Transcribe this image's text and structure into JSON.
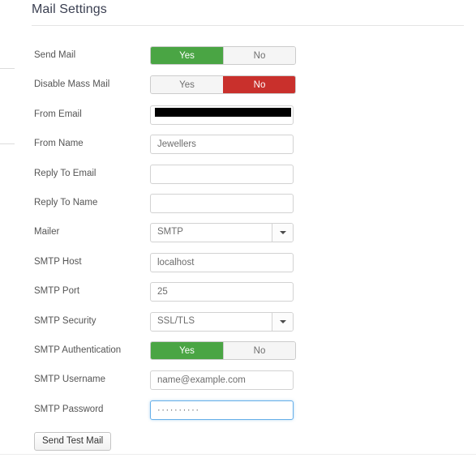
{
  "panel": {
    "title": "Mail Settings"
  },
  "form": {
    "rows": [
      {
        "label": "Send Mail",
        "type": "toggle",
        "yes": "Yes",
        "no": "No",
        "selected": "yes"
      },
      {
        "label": "Disable Mass Mail",
        "type": "toggle",
        "yes": "Yes",
        "no": "No",
        "selected": "no"
      },
      {
        "label": "From Email",
        "type": "redacted",
        "value": "",
        "redacted": true
      },
      {
        "label": "From Name",
        "type": "text",
        "value": "Jewellers",
        "placeholder": ""
      },
      {
        "label": "Reply To Email",
        "type": "text",
        "value": "",
        "placeholder": ""
      },
      {
        "label": "Reply To Name",
        "type": "text",
        "value": "",
        "placeholder": ""
      },
      {
        "label": "Mailer",
        "type": "select",
        "value": "SMTP"
      },
      {
        "label": "SMTP Host",
        "type": "text",
        "value": "localhost",
        "placeholder": ""
      },
      {
        "label": "SMTP Port",
        "type": "text",
        "value": "25",
        "placeholder": ""
      },
      {
        "label": "SMTP Security",
        "type": "select",
        "value": "SSL/TLS"
      },
      {
        "label": "SMTP Authentication",
        "type": "toggle",
        "yes": "Yes",
        "no": "No",
        "selected": "yes"
      },
      {
        "label": "SMTP Username",
        "type": "text",
        "value": "name@example.com",
        "placeholder": ""
      },
      {
        "label": "SMTP Password",
        "type": "password",
        "value": "··········",
        "focused": true
      }
    ]
  },
  "actions": {
    "send_test_mail": "Send Test Mail"
  },
  "colors": {
    "toggle_yes_active": "#4aa544",
    "toggle_no_active": "#c9302c",
    "input_focus_border": "#66afe9",
    "title_color": "#3a3f51"
  }
}
